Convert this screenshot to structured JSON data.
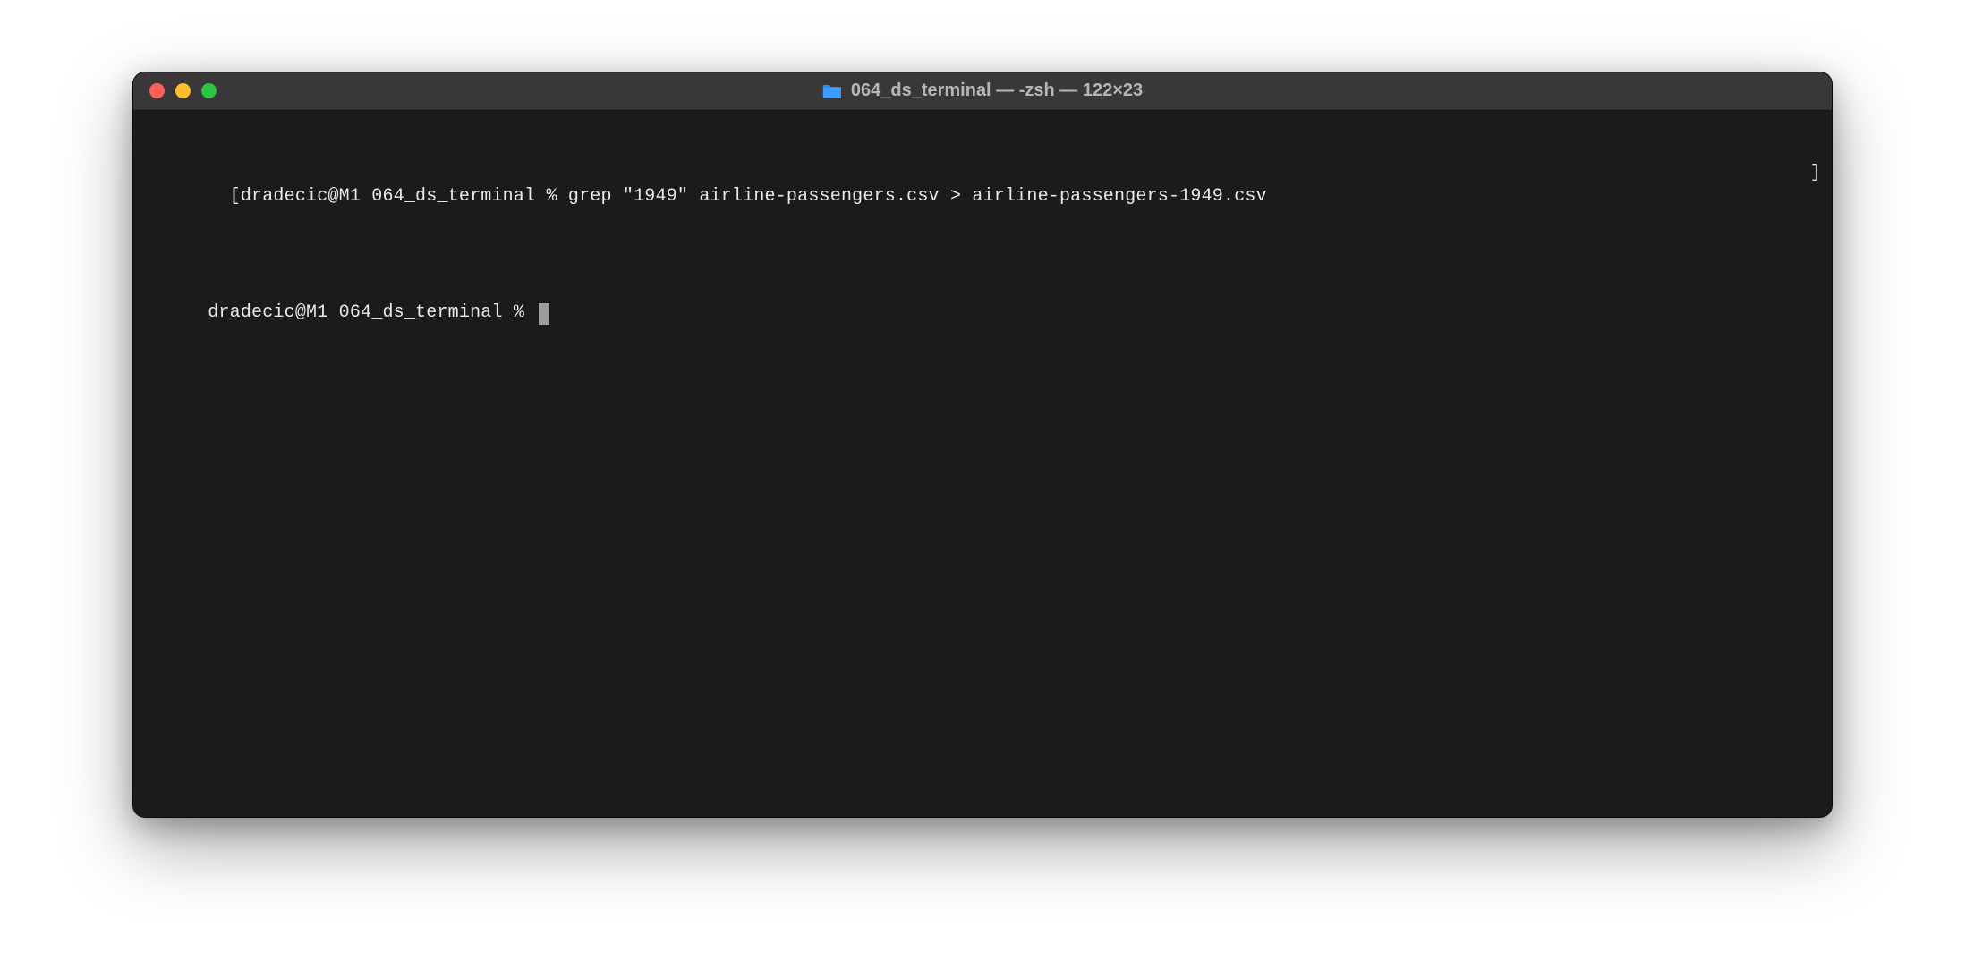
{
  "window": {
    "title": "064_ds_terminal — -zsh — 122×23"
  },
  "terminal": {
    "lines": [
      {
        "left_bracket": "[",
        "prompt": "dradecic@M1 064_ds_terminal % ",
        "command": "grep \"1949\" airline-passengers.csv > airline-passengers-1949.csv",
        "right_bracket": "]"
      },
      {
        "left_bracket": "",
        "prompt": "dradecic@M1 064_ds_terminal % ",
        "command": "",
        "right_bracket": ""
      }
    ]
  }
}
